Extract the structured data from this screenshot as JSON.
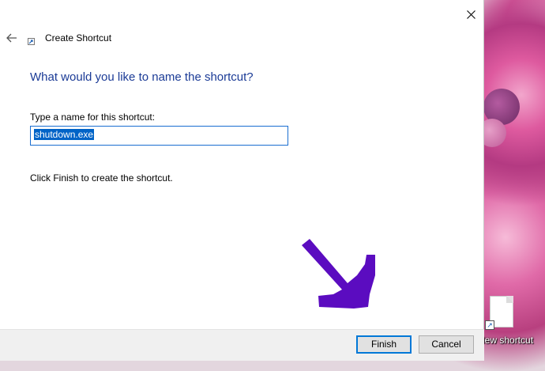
{
  "window": {
    "title": "Create Shortcut",
    "heading": "What would you like to name the shortcut?",
    "field_label": "Type a name for this shortcut:",
    "field_value": "shutdown.exe",
    "hint": "Click Finish to create the shortcut.",
    "finish_label": "Finish",
    "cancel_label": "Cancel"
  },
  "desktop": {
    "icon_label": "New shortcut"
  },
  "colors": {
    "heading": "#1b3b96",
    "selection": "#0063c7",
    "annotation_arrow": "#5b0cc0",
    "focus_border": "#0078d7"
  },
  "icons": [
    "close-icon",
    "back-arrow-icon",
    "shortcut-icon",
    "document-icon"
  ]
}
